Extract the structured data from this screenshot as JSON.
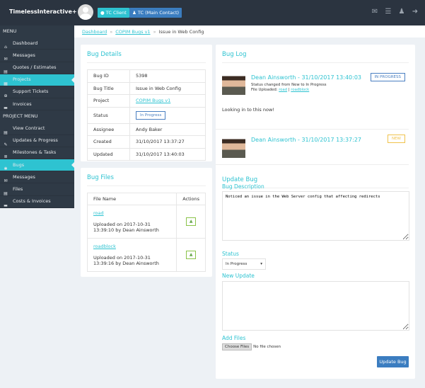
{
  "header": {
    "brand": "TimelessInteractive+",
    "client_label": "TC Client",
    "contact_label": "TC  (Main Contact)",
    "icons": [
      "envelope-open-icon",
      "sliders-icon",
      "users-icon",
      "sign-out-icon"
    ]
  },
  "sidebar": {
    "menu_title": "MENU",
    "items": [
      {
        "label": "Dashboard",
        "icon": "home-icon"
      },
      {
        "label": "Messages",
        "icon": "envelope-icon"
      },
      {
        "label": "Quotes / Estimates",
        "icon": "file-icon"
      },
      {
        "label": "Projects",
        "icon": "grid-icon",
        "active": true
      },
      {
        "label": "Support Tickets",
        "icon": "lifebuoy-icon"
      },
      {
        "label": "Invoices",
        "icon": "credit-card-icon"
      }
    ],
    "project_menu_title": "PROJECT MENU",
    "project_items": [
      {
        "label": "View Contract",
        "icon": "file-icon"
      },
      {
        "label": "Updates & Progress",
        "icon": "edit-icon"
      },
      {
        "label": "Milestones & Tasks",
        "icon": "tasks-icon"
      },
      {
        "label": "Bugs",
        "icon": "bug-icon",
        "active": true
      },
      {
        "label": "Messages",
        "icon": "envelope-icon"
      },
      {
        "label": "Files",
        "icon": "file-icon"
      },
      {
        "label": "Costs & Invoices",
        "icon": "credit-card-icon"
      }
    ]
  },
  "breadcrumb": [
    "Dashboard",
    "COPIM Bugs v1",
    "Issue in Web Config"
  ],
  "details": {
    "title": "Bug Details",
    "rows": [
      {
        "k": "Bug ID",
        "v": "5398"
      },
      {
        "k": "Bug Title",
        "v": "Issue in Web Config"
      },
      {
        "k": "Project",
        "v": "COPIM Bugs v1"
      },
      {
        "k": "Status",
        "v": "In Progress"
      },
      {
        "k": "Assignee",
        "v": "Andy Baker"
      },
      {
        "k": "Created",
        "v": "31/10/2017 13:37:27"
      },
      {
        "k": "Updated",
        "v": "31/10/2017 13:40:03"
      }
    ]
  },
  "files": {
    "title": "Bug Files",
    "col_name": "File Name",
    "col_actions": "Actions",
    "rows": [
      {
        "name": "road",
        "info": "Uploaded on 2017-10-31 13:39:10 by Dean Ainsworth"
      },
      {
        "name": "roadblock",
        "info": "Uploaded on 2017-10-31 13:39:16 by Dean Ainsworth"
      }
    ]
  },
  "log": {
    "title": "Bug Log",
    "entries": [
      {
        "author": "Dean Ainsworth - 31/10/2017 13:40:03",
        "status": "IN PROGRESS",
        "status_color": "#4a7fc1",
        "change": "Status changed from New to In Progress",
        "files_label": "File Uploaded:",
        "files": [
          "road",
          "roadblock"
        ],
        "comment": "Looking in to this now!"
      },
      {
        "author": "Dean Ainsworth - 31/10/2017 13:37:27",
        "status": "NEW",
        "status_color": "#f0c24b"
      }
    ]
  },
  "update": {
    "title": "Update Bug",
    "desc_label": "Bug Description",
    "desc_value": "Noticed an issue in the Web Server config that affecting redirects",
    "status_label": "Status",
    "status_value": "In Progress",
    "new_update_label": "New Update",
    "new_update_value": "",
    "add_files_label": "Add Files",
    "choose_files": "Choose Files",
    "no_file": "No file chosen",
    "submit": "Update Bug"
  },
  "colors": {
    "accent": "#2ec3d1",
    "header_bg": "#2b3440",
    "sidebar_bg": "#2f3a46",
    "primary": "#3b7dc0"
  }
}
